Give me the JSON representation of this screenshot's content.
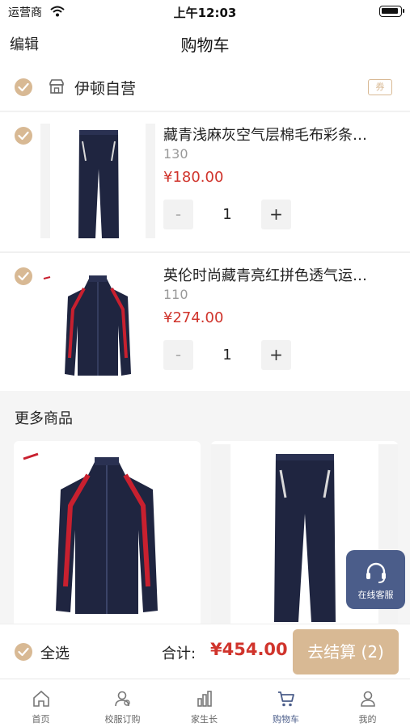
{
  "status_bar": {
    "carrier": "运营商",
    "time": "上午12:03"
  },
  "nav": {
    "edit_label": "编辑",
    "title": "购物车"
  },
  "store": {
    "name": "伊顿自营",
    "coupon_label": "券"
  },
  "cart_items": [
    {
      "name": "藏青浅麻灰空气层棉毛布彩条…",
      "spec": "130",
      "price": "¥180.00",
      "quantity": "1",
      "minus": "-",
      "plus": "+",
      "image": "navy-track-pants"
    },
    {
      "name": "英伦时尚藏青亮红拼色透气运…",
      "spec": "110",
      "price": "¥274.00",
      "quantity": "1",
      "minus": "-",
      "plus": "+",
      "image": "navy-red-track-jacket"
    }
  ],
  "more": {
    "title": "更多商品",
    "products": [
      {
        "image": "navy-red-track-jacket"
      },
      {
        "image": "navy-track-pants"
      }
    ]
  },
  "service": {
    "label": "在线客服",
    "icon": "headset-icon"
  },
  "checkout": {
    "select_all": "全选",
    "total_label": "合计:",
    "total_value": "¥454.00",
    "pay_label": "去结算 (2)"
  },
  "tabs": [
    {
      "label": "首页",
      "icon": "home-icon",
      "active": false
    },
    {
      "label": "校服订购",
      "icon": "uniform-order-icon",
      "active": false
    },
    {
      "label": "家生长",
      "icon": "growth-icon",
      "active": false
    },
    {
      "label": "购物车",
      "icon": "cart-icon",
      "active": true
    },
    {
      "label": "我的",
      "icon": "user-icon",
      "active": false
    }
  ],
  "colors": {
    "accent": "#d8b994",
    "price": "#d0342c",
    "primary": "#4b5d8a",
    "product_navy": "#1f2540",
    "product_red": "#c8202f"
  }
}
